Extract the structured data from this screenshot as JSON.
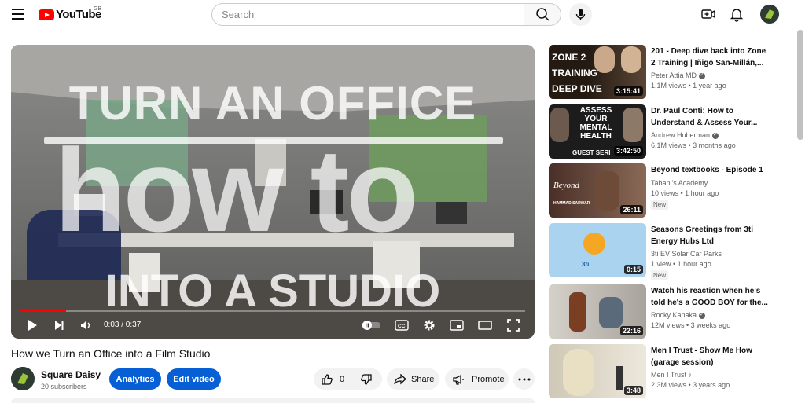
{
  "header": {
    "logo_text": "YouTube",
    "region": "GB",
    "search_placeholder": "Search"
  },
  "player": {
    "overlay_line1": "TURN AN OFFICE",
    "overlay_line2": "how to",
    "overlay_line3": "INTO A STUDIO",
    "time": "0:03 / 0:37",
    "progress_fraction": 0.09
  },
  "video": {
    "title": "How we Turn an Office into a Film Studio",
    "channel": "Square Daisy",
    "subscribers": "20 subscribers",
    "analytics_label": "Analytics",
    "edit_label": "Edit video",
    "likes": "0",
    "share_label": "Share",
    "promote_label": "Promote"
  },
  "related": [
    {
      "title": "201 - Deep dive back into Zone 2 Training | Iñigo San-Millán,...",
      "channel": "Peter Attia MD",
      "verified": true,
      "meta": "1.1M views • 1 year ago",
      "duration": "3:15:41",
      "thumb_text": [
        "ZONE 2",
        "TRAINING",
        "DEEP DIVE"
      ],
      "is_new": false
    },
    {
      "title": "Dr. Paul Conti: How to Understand & Assess Your...",
      "channel": "Andrew Huberman",
      "verified": true,
      "meta": "6.1M views • 3 months ago",
      "duration": "3:42:50",
      "thumb_text": [
        "ASSESS",
        "YOUR",
        "MENTAL",
        "HEALTH",
        "GUEST SERI"
      ],
      "is_new": false
    },
    {
      "title": "Beyond textbooks - Episode 1",
      "channel": "Tabani's Academy",
      "verified": false,
      "meta": "10 views • 1 hour ago",
      "duration": "26:11",
      "thumb_text": [
        "Beyond",
        "HAMMAD SARWAR"
      ],
      "is_new": true,
      "new_label": "New"
    },
    {
      "title": "Seasons Greetings from 3ti Energy Hubs Ltd",
      "channel": "3ti EV Solar Car Parks",
      "verified": false,
      "meta": "1 view • 1 hour ago",
      "duration": "0:15",
      "thumb_text": [
        "3ti"
      ],
      "is_new": true,
      "new_label": "New"
    },
    {
      "title": "Watch his reaction when he's told he's a GOOD BOY for the...",
      "channel": "Rocky Kanaka",
      "verified": true,
      "meta": "12M views • 3 weeks ago",
      "duration": "22:16",
      "thumb_text": [],
      "is_new": false
    },
    {
      "title": "Men I Trust - Show Me How (garage session)",
      "channel": "Men I Trust ♪",
      "verified": false,
      "meta": "2.3M views • 3 years ago",
      "duration": "3:48",
      "thumb_text": [],
      "is_new": false
    }
  ],
  "colors": {
    "brand_red": "#ff0000",
    "action_blue": "#065fd4"
  }
}
